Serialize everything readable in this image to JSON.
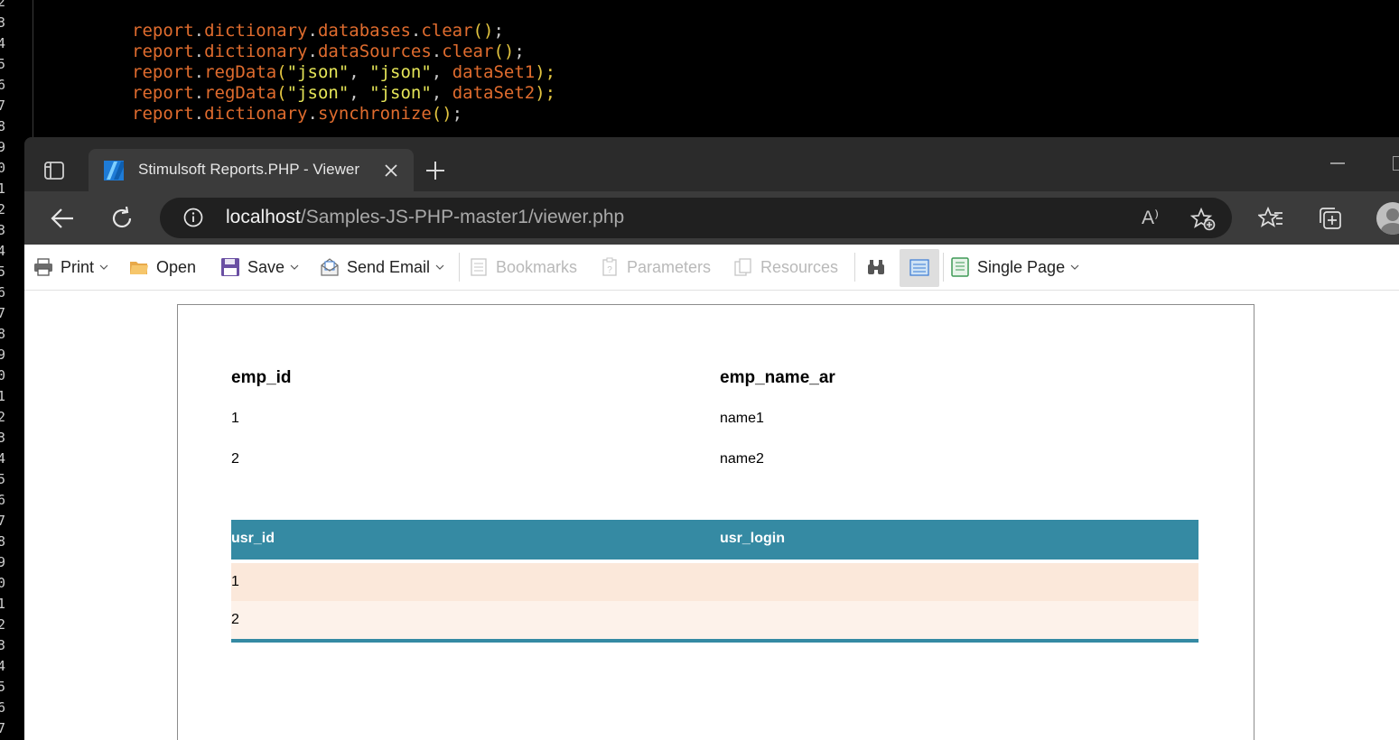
{
  "editor": {
    "line_numbers": [
      "2",
      "3",
      "4",
      "5",
      "6",
      "7",
      "8",
      "9",
      "0",
      "1",
      "2",
      "3",
      "4",
      "5",
      "6",
      "7",
      "8",
      "9",
      "0",
      "1",
      "2",
      "3",
      "4",
      "5",
      "6",
      "7",
      "8",
      "9",
      "0",
      "1",
      "2",
      "3",
      "4",
      "5",
      "6",
      "7"
    ],
    "code_lines": [
      [
        "report",
        ".",
        "dictionary",
        ".",
        "databases",
        ".",
        "clear",
        "()",
        ";"
      ],
      [
        "report",
        ".",
        "dictionary",
        ".",
        "dataSources",
        ".",
        "clear",
        "()",
        ";"
      ],
      [
        "report",
        ".",
        "regData",
        "(",
        "\"json\"",
        ", ",
        "\"json\"",
        ", ",
        "dataSet1",
        ");"
      ],
      [
        "report",
        ".",
        "regData",
        "(",
        "\"json\"",
        ", ",
        "\"json\"",
        ", ",
        "dataSet2",
        ");"
      ],
      [
        "report",
        ".",
        "dictionary",
        ".",
        "synchronize",
        "()",
        ";"
      ]
    ]
  },
  "browser": {
    "tab": {
      "title": "Stimulsoft Reports.PHP - Viewer"
    },
    "address": {
      "host": "localhost",
      "path": "/Samples-JS-PHP-master1/viewer.php"
    },
    "read_aloud_label": "A⁾"
  },
  "toolbar": {
    "print": "Print",
    "open": "Open",
    "save": "Save",
    "send_email": "Send Email",
    "bookmarks": "Bookmarks",
    "parameters": "Parameters",
    "resources": "Resources",
    "view_mode": "Single Page"
  },
  "report": {
    "employees": {
      "columns": [
        "emp_id",
        "emp_name_ar"
      ],
      "rows": [
        [
          "1",
          "name1"
        ],
        [
          "2",
          "name2"
        ]
      ]
    },
    "users": {
      "columns": [
        "usr_id",
        "usr_login"
      ],
      "rows": [
        [
          "1",
          ""
        ],
        [
          "2",
          ""
        ]
      ],
      "colors": {
        "header": "#358aa3",
        "row_odd": "#fbe8da",
        "row_even": "#fdf2ea"
      }
    }
  }
}
